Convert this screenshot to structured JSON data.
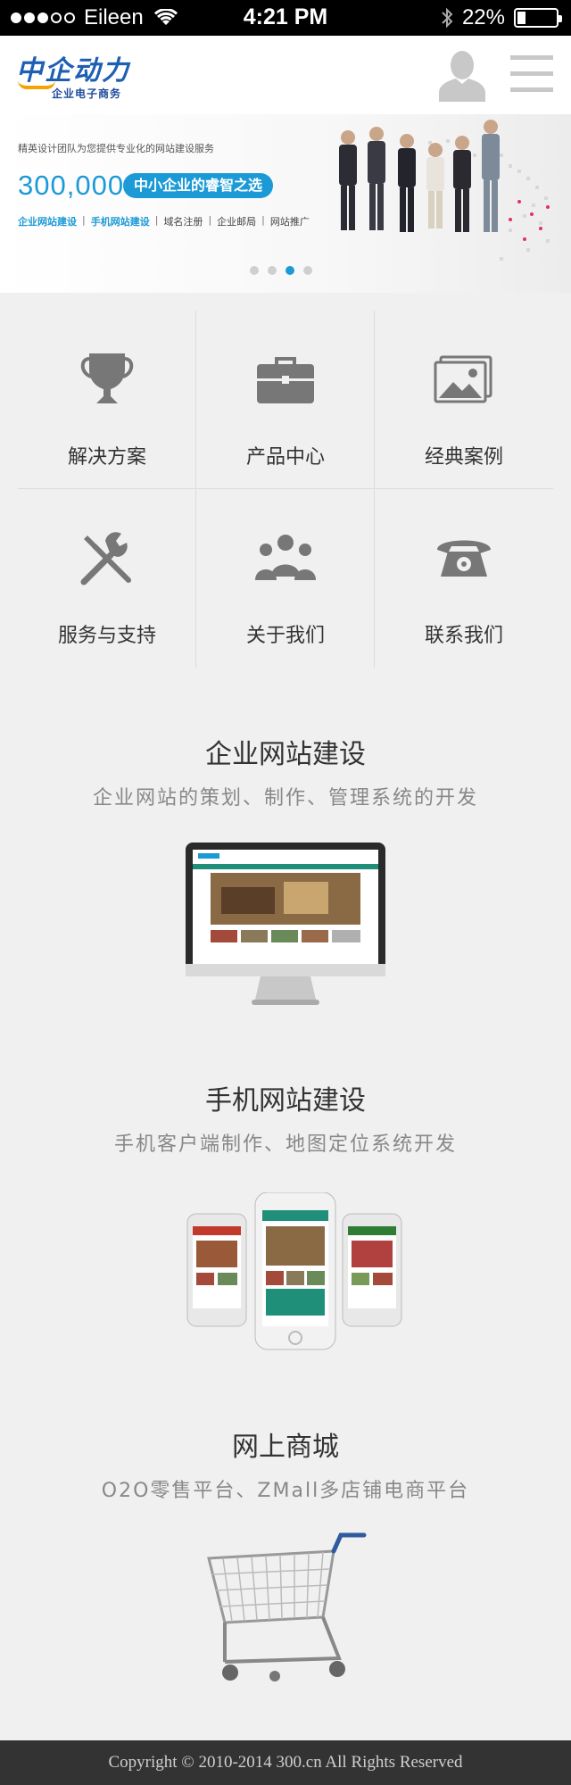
{
  "status_bar": {
    "carrier": "Eileen",
    "time": "4:21 PM",
    "battery": "22%",
    "battery_level": 0.22,
    "signal_bars_filled": 3,
    "signal_bars_total": 5
  },
  "header": {
    "logo_text": "中企动力",
    "logo_sub": "企业电子商务",
    "user_icon": "user-icon",
    "menu_icon": "hamburger-menu-icon"
  },
  "banner": {
    "description": "精英设计团队为您提供专业化的网站建设服务",
    "number": "300,000",
    "tagline": "中小企业的睿智之选",
    "links": [
      "企业网站建设",
      "手机网站建设",
      "域名注册",
      "企业邮局",
      "网站推广"
    ],
    "slide_count": 4,
    "active_slide": 3
  },
  "nav": [
    {
      "label": "解决方案",
      "icon": "trophy-icon"
    },
    {
      "label": "产品中心",
      "icon": "briefcase-icon"
    },
    {
      "label": "经典案例",
      "icon": "image-gallery-icon"
    },
    {
      "label": "服务与支持",
      "icon": "tools-icon"
    },
    {
      "label": "关于我们",
      "icon": "team-icon"
    },
    {
      "label": "联系我们",
      "icon": "telephone-icon"
    }
  ],
  "features": [
    {
      "title": "企业网站建设",
      "subtitle": "企业网站的策划、制作、管理系统的开发",
      "icon": "desktop-monitor-icon"
    },
    {
      "title": "手机网站建设",
      "subtitle": "手机客户端制作、地图定位系统开发",
      "icon": "smartphones-icon"
    },
    {
      "title": "网上商城",
      "subtitle": "O2O零售平台、ZMall多店铺电商平台",
      "icon": "shopping-cart-icon"
    }
  ],
  "footer": {
    "copyright": "Copyright © 2010-2014 300.cn All Rights Reserved"
  },
  "colors": {
    "accent": "#1c9ad6",
    "logo_blue": "#1e5fb4",
    "logo_orange": "#f4a300",
    "background": "#f0f0f0",
    "footer_bg": "#333333"
  }
}
